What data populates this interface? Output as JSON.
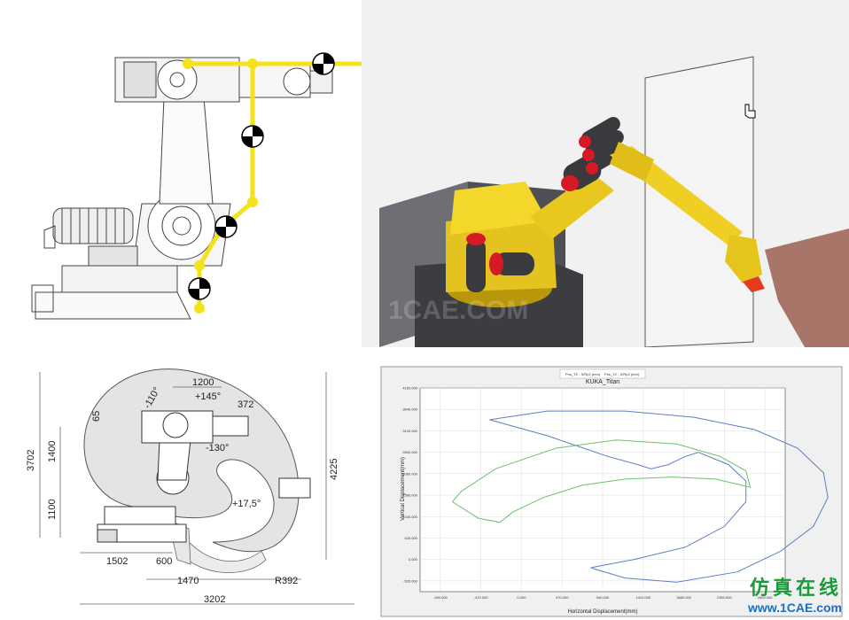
{
  "watermark": {
    "cn": "仿真在线",
    "url": "www.1CAE.com",
    "faint": "1CAE.COM"
  },
  "dims": {
    "a1200": "1200",
    "a145": "+145°",
    "a110": "-110°",
    "a65": "65",
    "a372": "372",
    "a130": "-130°",
    "a175": "+17,5°",
    "a3702": "3702",
    "a1400": "1400",
    "a1100": "1100",
    "a4225": "4225",
    "a1502": "1502",
    "a600": "600",
    "a1470": "1470",
    "aR392": "R392",
    "a3202": "3202"
  },
  "chart_data": {
    "type": "line",
    "title": "KUKA_Titan",
    "xlabel": "Horizontal Displacement(mm)",
    "ylabel": "Vertical Displacement(mm)",
    "legend": [
      "Pos_TZ - S/Rp2 (mm)",
      "Pos_TZ - S/Rp2 (mm)"
    ],
    "xticks": [
      "-940.000",
      "-470.000",
      "0.000",
      "470.000",
      "940.000",
      "1410.000",
      "1880.000",
      "2350.000",
      "2820.000"
    ],
    "yticks": [
      "4160.000",
      "3640.000",
      "3120.000",
      "2600.000",
      "2080.000",
      "1560.000",
      "1040.000",
      "520.000",
      "0.000",
      "-520.000"
    ],
    "xlim": [
      -1175,
      3055
    ],
    "ylim": [
      -780,
      4160
    ],
    "series": [
      {
        "color": "#5b7fc2",
        "values": [
          [
            -370,
            3390
          ],
          [
            300,
            3600
          ],
          [
            1200,
            3600
          ],
          [
            2000,
            3450
          ],
          [
            2700,
            3150
          ],
          [
            3200,
            2700
          ],
          [
            3500,
            2100
          ],
          [
            3550,
            1500
          ],
          [
            3380,
            800
          ],
          [
            3000,
            200
          ],
          [
            2500,
            -300
          ],
          [
            1800,
            -550
          ],
          [
            1200,
            -450
          ],
          [
            800,
            -200
          ],
          [
            1300,
            0
          ],
          [
            1900,
            300
          ],
          [
            2350,
            800
          ],
          [
            2600,
            1400
          ],
          [
            2600,
            1900
          ],
          [
            2400,
            2300
          ],
          [
            2050,
            2600
          ],
          [
            1900,
            2500
          ],
          [
            1700,
            2300
          ],
          [
            1500,
            2200
          ],
          [
            1350,
            2300
          ],
          [
            1000,
            2500
          ],
          [
            300,
            3000
          ],
          [
            -370,
            3390
          ]
        ]
      },
      {
        "color": "#6cc06c",
        "values": [
          [
            -700,
            1650
          ],
          [
            -300,
            2200
          ],
          [
            400,
            2700
          ],
          [
            1100,
            2900
          ],
          [
            1800,
            2800
          ],
          [
            2300,
            2500
          ],
          [
            2600,
            2150
          ],
          [
            2650,
            1750
          ],
          [
            2250,
            1950
          ],
          [
            1750,
            2000
          ],
          [
            1200,
            1950
          ],
          [
            700,
            1800
          ],
          [
            250,
            1500
          ],
          [
            -100,
            1150
          ],
          [
            -250,
            900
          ],
          [
            -500,
            1000
          ],
          [
            -800,
            1400
          ],
          [
            -700,
            1650
          ]
        ]
      }
    ]
  }
}
